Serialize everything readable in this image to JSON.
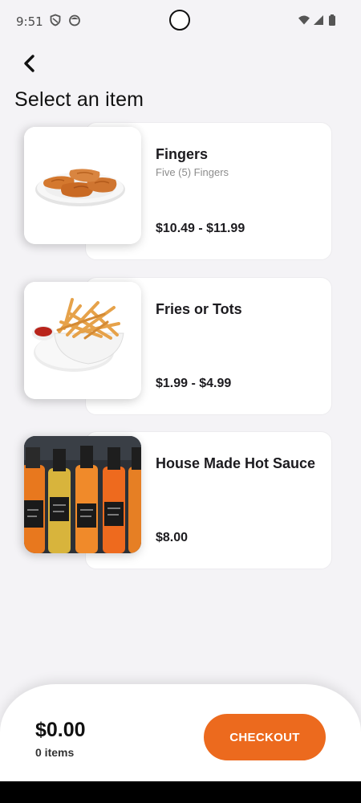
{
  "status_bar": {
    "time": "9:51",
    "left_icons": [
      "shield-icon",
      "app-notification-icon"
    ],
    "right_icons": [
      "wifi-icon",
      "cell-signal-icon",
      "battery-icon"
    ]
  },
  "header": {
    "back_icon": "chevron-left-icon",
    "title": "Select an item"
  },
  "items": [
    {
      "name": "Fingers",
      "description": "Five (5) Fingers",
      "price": "$10.49 - $11.99",
      "image": "chicken-fingers-photo"
    },
    {
      "name": "Fries or Tots",
      "description": "",
      "price": "$1.99 - $4.99",
      "image": "fries-bowl-photo"
    },
    {
      "name": "House Made Hot Sauce",
      "description": "",
      "price": "$8.00",
      "image": "hot-sauce-bottles-photo"
    }
  ],
  "cart": {
    "total": "$0.00",
    "count": "0 items",
    "checkout_label": "CHECKOUT"
  },
  "colors": {
    "accent": "#ec6a1e",
    "background": "#f4f3f6",
    "card": "#ffffff",
    "text": "#1c1b1f",
    "muted": "#8c8c8c"
  }
}
